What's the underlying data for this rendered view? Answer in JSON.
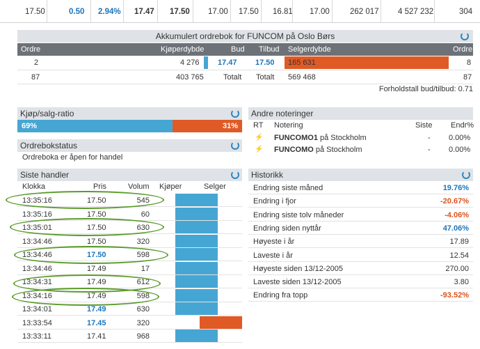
{
  "quote": {
    "last": "17.50",
    "change": "0.50",
    "change_pct": "2.94%",
    "bid": "17.47",
    "ask": "17.50",
    "high": "17.00",
    "open": "17.50",
    "low": "16.81",
    "prev": "17.00",
    "volume": "262 017",
    "turnover": "4 527 232",
    "trades": "304"
  },
  "orderbook": {
    "title": "Akkumulert ordrebok for FUNCOM på Oslo Børs",
    "headers": {
      "orders": "Ordre",
      "buy_depth": "Kjøperdybde",
      "bid": "Bud",
      "ask": "Tilbud",
      "sell_depth": "Selgerdybde",
      "orders_r": "Ordre"
    },
    "row": {
      "orders": "2",
      "buy_depth": "4 276",
      "bid": "17.47",
      "ask": "17.50",
      "sell_depth": "165 631",
      "orders_r": "8"
    },
    "totals": {
      "orders": "87",
      "buy_total": "403 765",
      "total_label_l": "Totalt",
      "total_label_r": "Totalt",
      "sell_total": "569 468",
      "orders_r": "87"
    },
    "ratio": "Forholdstall bud/tilbud: 0.71"
  },
  "ratio_panel": {
    "title": "Kjøp/salg-ratio",
    "buy_label": "69%",
    "sell_label": "31%",
    "buy_fraction": 0.69
  },
  "status_panel": {
    "title": "Ordrebokstatus",
    "text": "Ordreboka er åpen for handel"
  },
  "trades_panel": {
    "title": "Siste handler",
    "headers": {
      "time": "Klokka",
      "price": "Pris",
      "volume": "Volum",
      "buyer": "Kjøper",
      "seller": "Selger"
    },
    "rows": [
      {
        "time": "13:35:16",
        "price": "17.50",
        "volume": "545",
        "side": "buy",
        "hl": false
      },
      {
        "time": "13:35:16",
        "price": "17.50",
        "volume": "60",
        "side": "buy",
        "hl": false
      },
      {
        "time": "13:35:01",
        "price": "17.50",
        "volume": "630",
        "side": "buy",
        "hl": false
      },
      {
        "time": "13:34:46",
        "price": "17.50",
        "volume": "320",
        "side": "buy",
        "hl": false
      },
      {
        "time": "13:34:46",
        "price": "17.50",
        "volume": "598",
        "side": "buy",
        "hl": true
      },
      {
        "time": "13:34:46",
        "price": "17.49",
        "volume": "17",
        "side": "buy",
        "hl": false
      },
      {
        "time": "13:34:31",
        "price": "17.49",
        "volume": "612",
        "side": "buy",
        "hl": false
      },
      {
        "time": "13:34:16",
        "price": "17.49",
        "volume": "598",
        "side": "buy",
        "hl": false
      },
      {
        "time": "13:34:01",
        "price": "17.49",
        "volume": "630",
        "side": "buy",
        "hl": true
      },
      {
        "time": "13:33:54",
        "price": "17.45",
        "volume": "320",
        "side": "sell",
        "hl": true
      },
      {
        "time": "13:33:11",
        "price": "17.41",
        "volume": "968",
        "side": "buy",
        "hl": false
      }
    ]
  },
  "other_listings": {
    "title": "Andre noteringer",
    "headers": {
      "rt": "RT",
      "listing": "Notering",
      "last": "Siste",
      "change": "Endr%"
    },
    "rows": [
      {
        "ticker": "FUNCOMO1",
        "place": "på Stockholm",
        "last": "-",
        "change": "0.00%"
      },
      {
        "ticker": "FUNCOMO",
        "place": "på Stockholm",
        "last": "-",
        "change": "0.00%"
      }
    ]
  },
  "history": {
    "title": "Historikk",
    "rows": [
      {
        "label": "Endring siste måned",
        "value": "19.76%",
        "tone": "pos"
      },
      {
        "label": "Endring i fjor",
        "value": "-20.67%",
        "tone": "neg"
      },
      {
        "label": "Endring siste tolv måneder",
        "value": "-4.06%",
        "tone": "neg"
      },
      {
        "label": "Endring siden nyttår",
        "value": "47.06%",
        "tone": "pos"
      },
      {
        "label": "Høyeste i år",
        "value": "17.89",
        "tone": "plain"
      },
      {
        "label": "Laveste i år",
        "value": "12.54",
        "tone": "plain"
      },
      {
        "label": "Høyeste siden 13/12-2005",
        "value": "270.00",
        "tone": "plain"
      },
      {
        "label": "Laveste siden 13/12-2005",
        "value": "3.80",
        "tone": "plain"
      },
      {
        "label": "Endring fra topp",
        "value": "-93.52%",
        "tone": "neg"
      }
    ]
  },
  "colors": {
    "accent": "#1b75bb",
    "buy": "#46a6d3",
    "sell": "#e05a26",
    "annotation": "#5a9b2c"
  }
}
